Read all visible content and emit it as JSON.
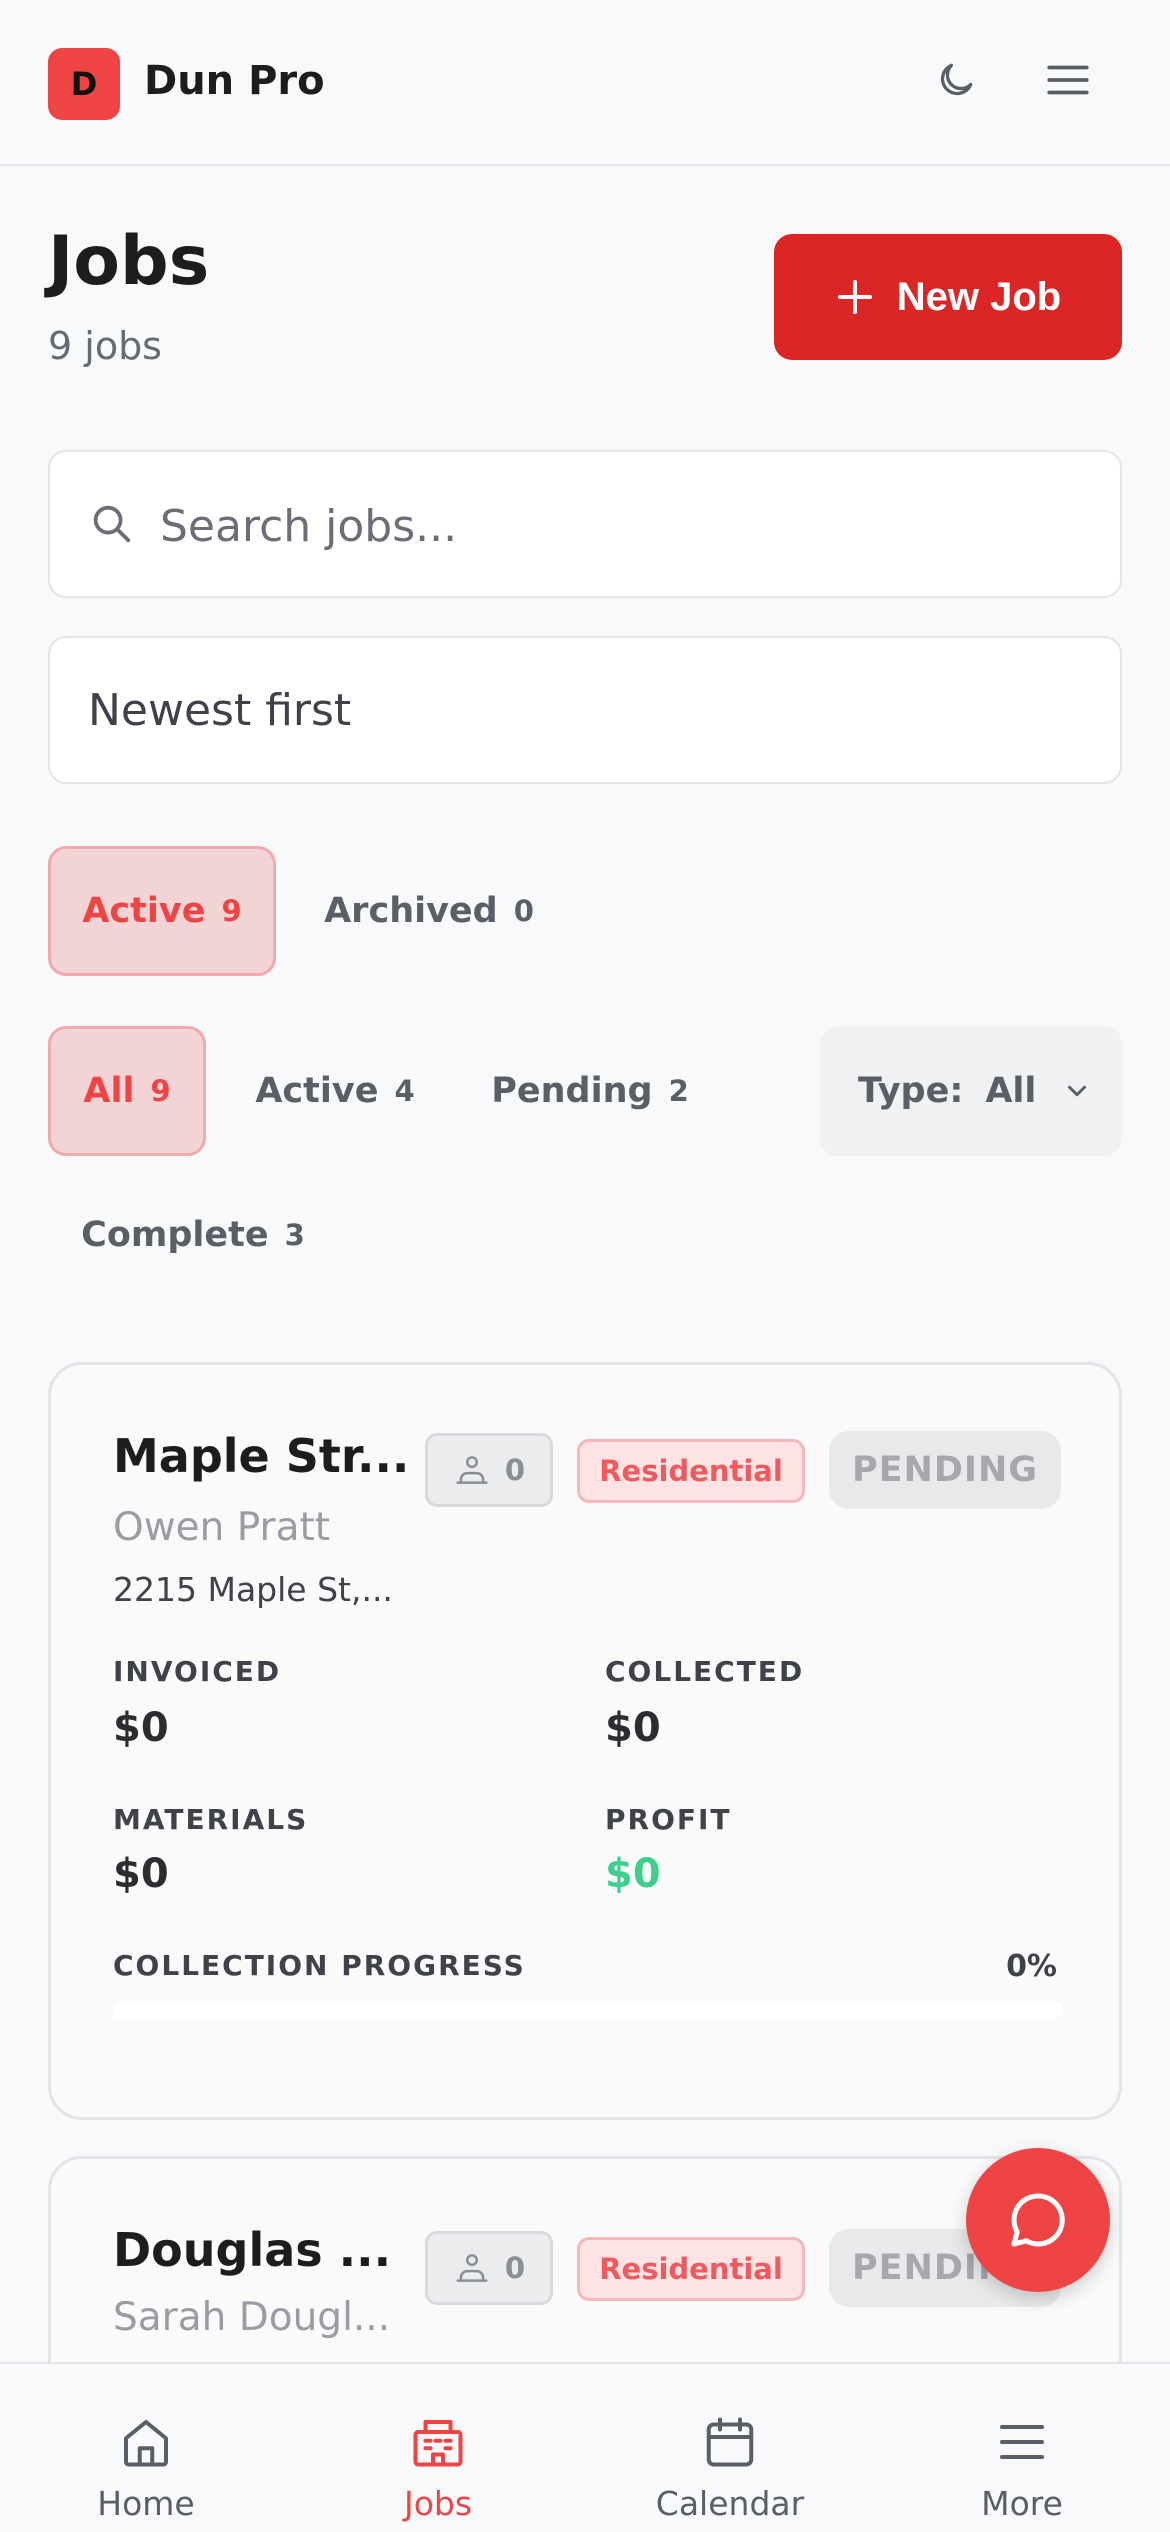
{
  "header": {
    "logo_letter": "D",
    "brand": "Dun Pro"
  },
  "page": {
    "title": "Jobs",
    "subtitle": "9 jobs",
    "new_job_label": "New Job"
  },
  "search": {
    "placeholder": "Search jobs..."
  },
  "sort": {
    "selected": "Newest first"
  },
  "archive_tabs": [
    {
      "label": "Active",
      "count": "9",
      "selected": true
    },
    {
      "label": "Archived",
      "count": "0",
      "selected": false
    }
  ],
  "status_filters": [
    {
      "label": "All",
      "count": "9",
      "selected": true
    },
    {
      "label": "Active",
      "count": "4",
      "selected": false
    },
    {
      "label": "Pending",
      "count": "2",
      "selected": false
    },
    {
      "label": "Complete",
      "count": "3",
      "selected": false
    }
  ],
  "type_filter": {
    "label": "Type:",
    "value": "All"
  },
  "jobs": [
    {
      "title": "Maple Str...",
      "client": "Owen Pratt",
      "address": "2215 Maple St,...",
      "crew_count": "0",
      "type": "Residential",
      "status": "PENDING",
      "invoiced_label": "INVOICED",
      "invoiced": "$0",
      "collected_label": "COLLECTED",
      "collected": "$0",
      "materials_label": "MATERIALS",
      "materials": "$0",
      "profit_label": "PROFIT",
      "profit": "$0",
      "progress_label": "COLLECTION PROGRESS",
      "progress_pct": "0%",
      "progress_value": 0
    },
    {
      "title": "Douglas ...",
      "client": "Sarah Dougl...",
      "crew_count": "0",
      "type": "Residential",
      "status": "PENDING"
    }
  ],
  "bottom_nav": [
    {
      "label": "Home",
      "icon": "home-icon",
      "selected": false
    },
    {
      "label": "Jobs",
      "icon": "building-icon",
      "selected": true
    },
    {
      "label": "Calendar",
      "icon": "calendar-icon",
      "selected": false
    },
    {
      "label": "More",
      "icon": "menu-icon",
      "selected": false
    }
  ],
  "colors": {
    "accent": "#ef4444",
    "primary_button": "#dc2626",
    "profit": "#3ecf8e"
  }
}
